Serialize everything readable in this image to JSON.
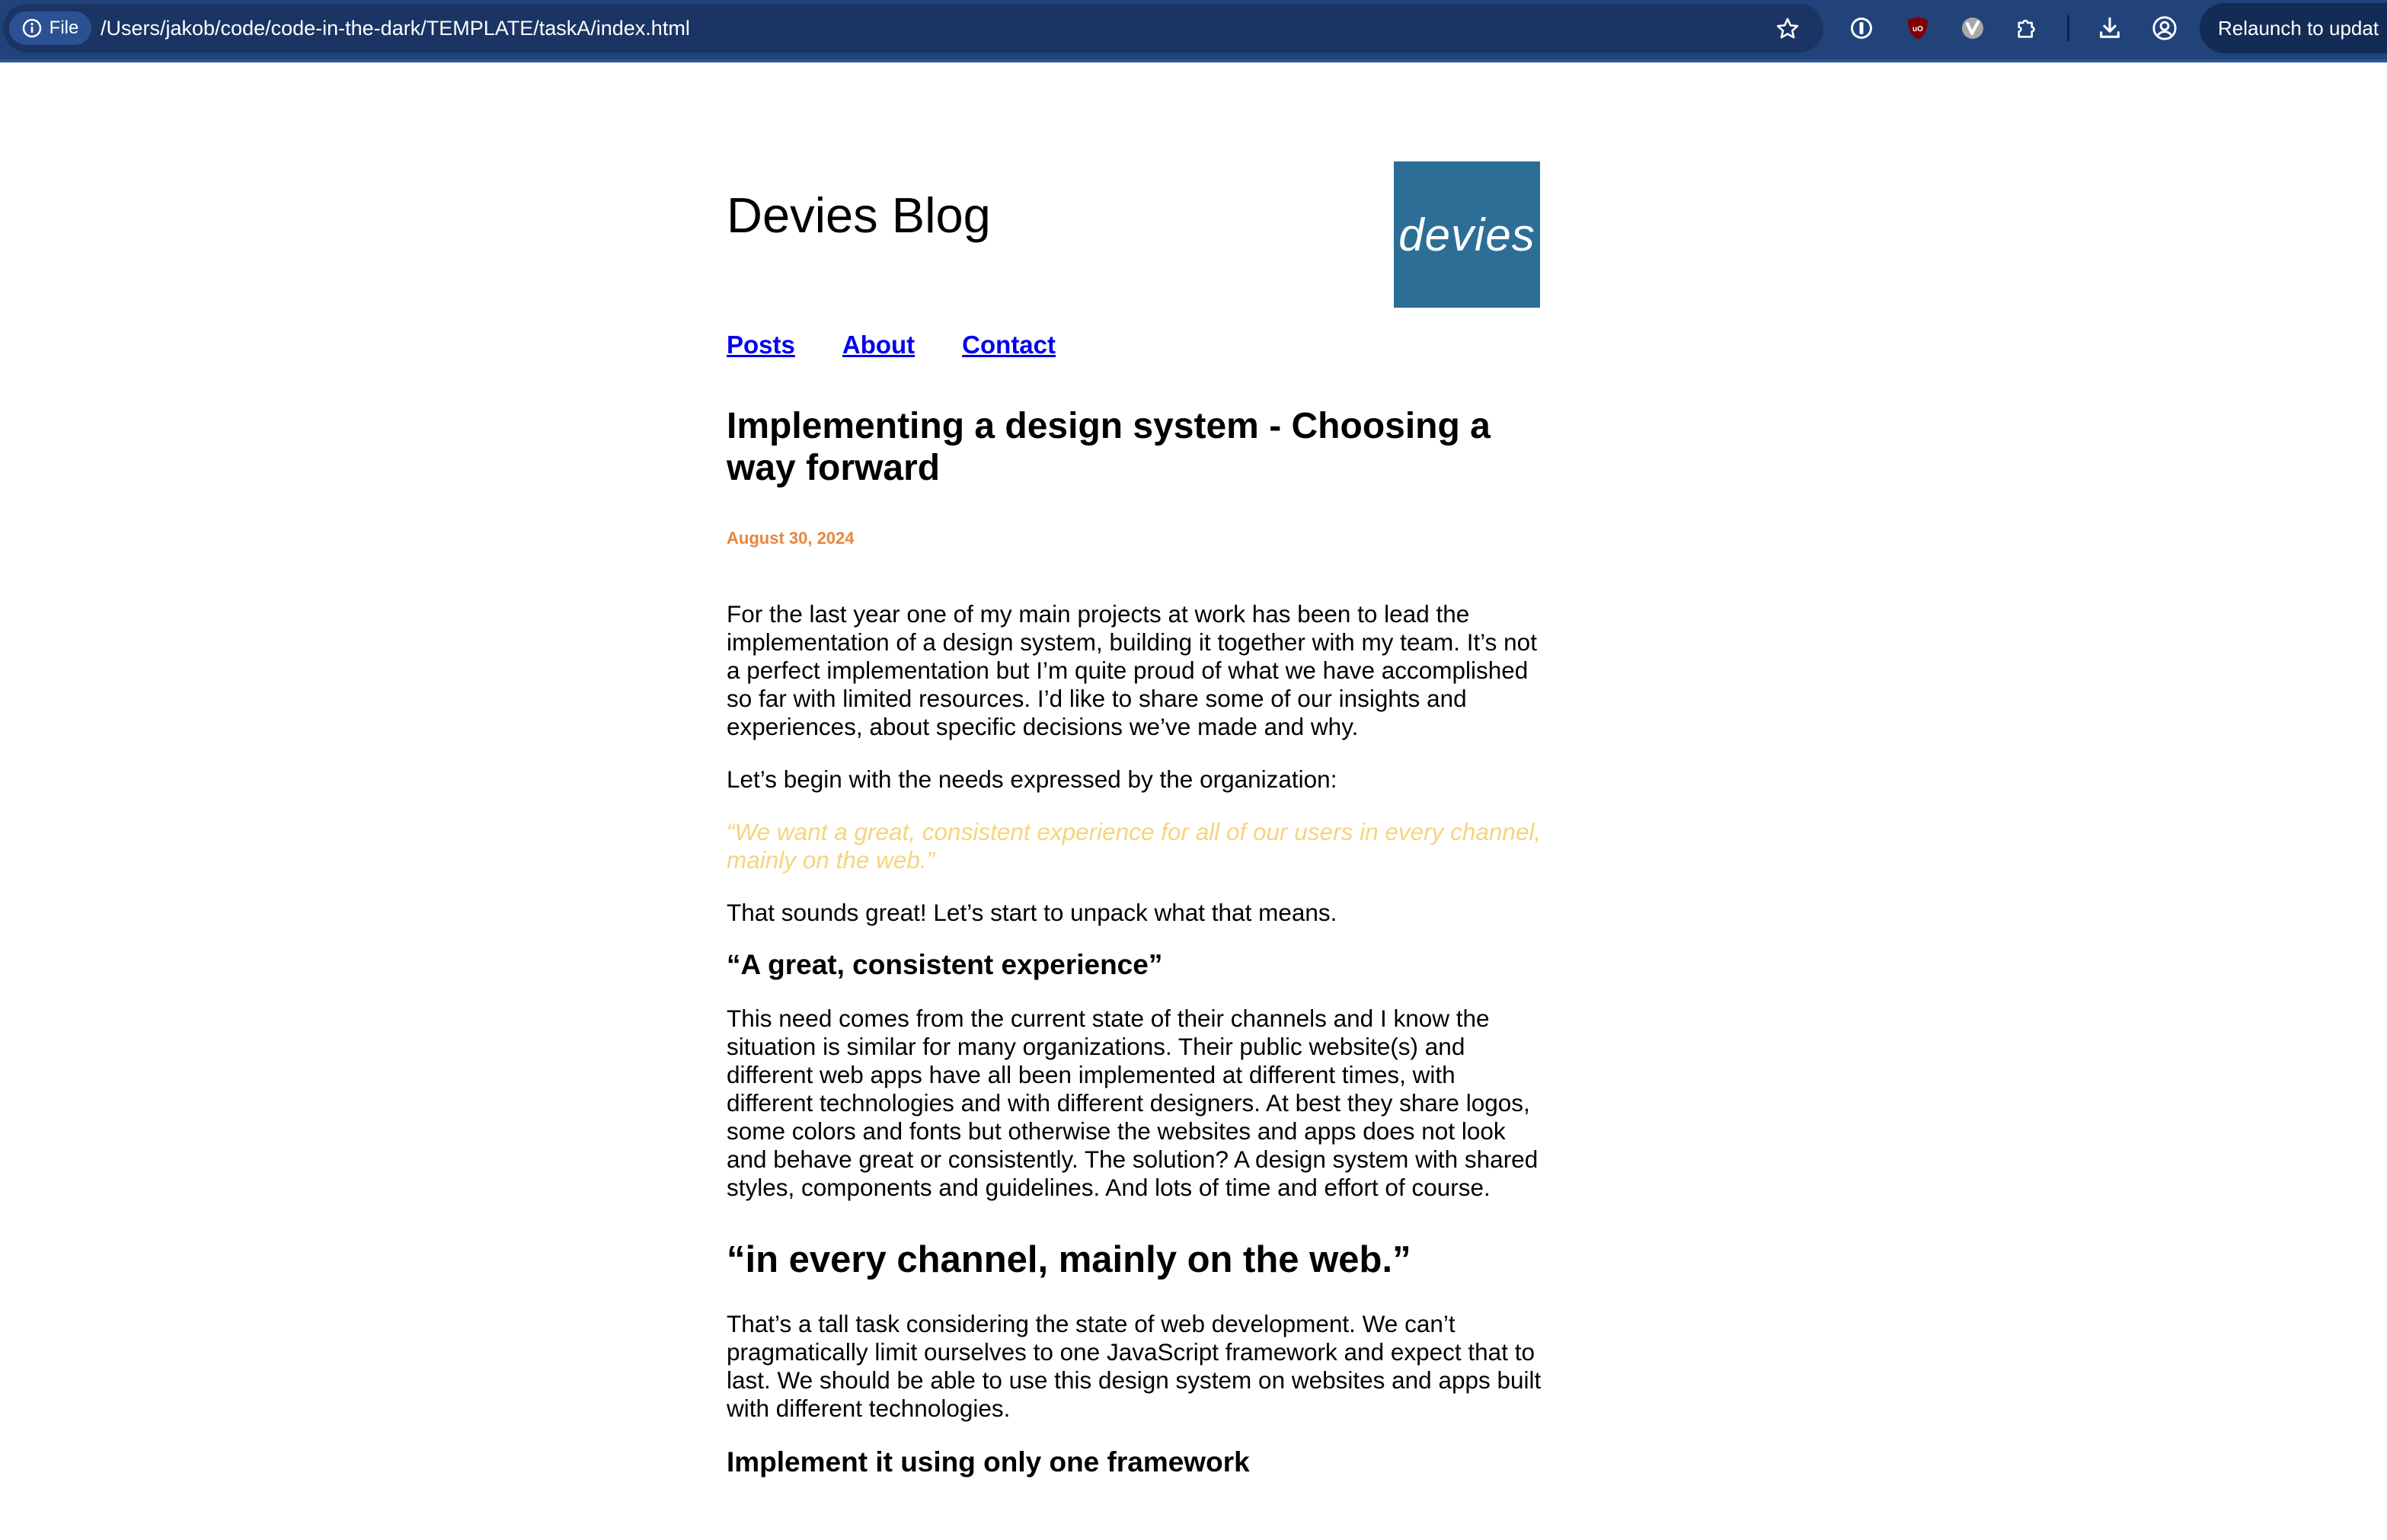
{
  "browser": {
    "file_chip_label": "File",
    "url": "/Users/jakob/code/code-in-the-dark/TEMPLATE/taskA/index.html",
    "relaunch_label": "Relaunch to updat",
    "icons": [
      "info-icon",
      "star-icon",
      "password-manager-icon",
      "ublock-icon",
      "vivaldi-extension-icon",
      "extensions-puzzle-icon",
      "download-icon",
      "profile-icon"
    ]
  },
  "site": {
    "title": "Devies Blog",
    "logo_text": "devies",
    "logo_color": "#2c6e96"
  },
  "nav": {
    "posts": "Posts",
    "about": "About",
    "contact": "Contact"
  },
  "post": {
    "title": "Implementing a design system - Choosing a way forward",
    "date": "August 30, 2024",
    "date_color": "#e8853d",
    "p1": "For the last year one of my main projects at work has been to lead the implementation of a design system, building it together with my team. It’s not a perfect implementation but I’m quite proud of what we have accomplished so far with limited resources. I’d like to share some of our insights and experiences, about specific decisions we’ve made and why.",
    "p2": "Let’s begin with the needs expressed by the organization:",
    "quote": "“We want a great, consistent experience for all of our users in every channel, mainly on the web.”",
    "quote_color": "#f6d47c",
    "p3": "That sounds great! Let’s start to unpack what that means.",
    "h_consistent": "“A great, consistent experience”",
    "p4": "This need comes from the current state of their channels and I know the situation is similar for many organizations. Their public website(s) and different web apps have all been implemented at different times, with different technologies and with different designers. At best they share logos, some colors and fonts but otherwise the websites and apps does not look and behave great or consistently. The solution? A design system with shared styles, components and guidelines. And lots of time and effort of course.",
    "h_channel": "“in every channel, mainly on the web.”",
    "p5": "That’s a tall task considering the state of web development. We can’t pragmatically limit ourselves to one JavaScript framework and expect that to last. We should be able to use this design system on websites and apps built with different technologies.",
    "h_framework": "Implement it using only one framework"
  }
}
